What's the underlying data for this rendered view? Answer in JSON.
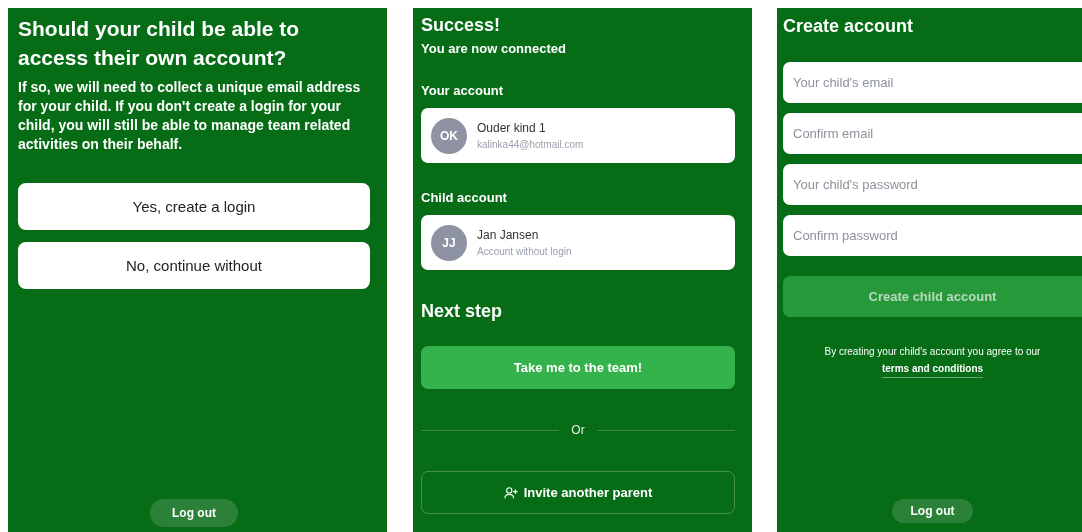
{
  "login_choice": {
    "title": "Should your child be able to access their own account?",
    "text": "If so, we will need to collect a unique email address for your child. If you don't create a login for your child, you will still be able to manage team related activities on their behalf.",
    "options": [
      "Yes, create a login",
      "No, continue without"
    ],
    "logout": "Log out"
  },
  "success": {
    "title": "Success!",
    "subtitle": "You are now connected",
    "sections": [
      {
        "heading": "Your account",
        "initials": "OK",
        "name": "Ouder kind 1",
        "detail": "kalinka44@hotmail.com"
      },
      {
        "heading": "Child account",
        "initials": "JJ",
        "name": "Jan Jansen",
        "detail": "Account without login"
      }
    ],
    "next_heading": "Next step",
    "primary_button": "Take me to the team!",
    "divider": "Or",
    "secondary_button": "Invite another parent"
  },
  "create_account": {
    "title": "Create account",
    "fields": [
      {
        "placeholder": "Your child's email"
      },
      {
        "placeholder": "Confirm email"
      },
      {
        "placeholder": "Your child's password"
      },
      {
        "placeholder": "Confirm password"
      }
    ],
    "submit": {
      "label": "Create child account",
      "disabled": true
    },
    "notice": "By creating your child's account you agree to our",
    "terms_link": "terms and conditions",
    "logout": "Log out"
  }
}
